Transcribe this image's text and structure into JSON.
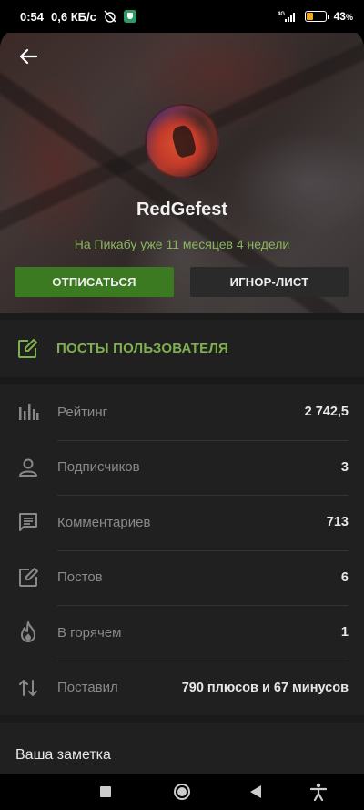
{
  "status_bar": {
    "time": "0:54",
    "speed": "0,6 КБ/с",
    "network": "4G",
    "battery": "43",
    "battery_level": 0.43
  },
  "profile": {
    "username": "RedGefest",
    "since": "На Пикабу уже 11 месяцев 4 недели",
    "unsubscribe_label": "ОТПИСАТЬСЯ",
    "ignore_label": "ИГНОР-ЛИСТ"
  },
  "posts_link": {
    "label": "ПОСТЫ ПОЛЬЗОВАТЕЛЯ"
  },
  "stats": [
    {
      "icon": "bar-chart-icon",
      "label": "Рейтинг",
      "value": "2 742,5"
    },
    {
      "icon": "person-icon",
      "label": "Подписчиков",
      "value": "3"
    },
    {
      "icon": "comment-icon",
      "label": "Комментариев",
      "value": "713"
    },
    {
      "icon": "edit-icon",
      "label": "Постов",
      "value": "6"
    },
    {
      "icon": "flame-icon",
      "label": "В горячем",
      "value": "1"
    },
    {
      "icon": "up-down-arrows-icon",
      "label": "Поставил",
      "value": "790 плюсов и 67 минусов"
    }
  ],
  "note": {
    "label": "Ваша заметка"
  },
  "colors": {
    "accent_green": "#7fb04f",
    "button_green": "#3c7a21",
    "background": "#1a1a1a"
  }
}
